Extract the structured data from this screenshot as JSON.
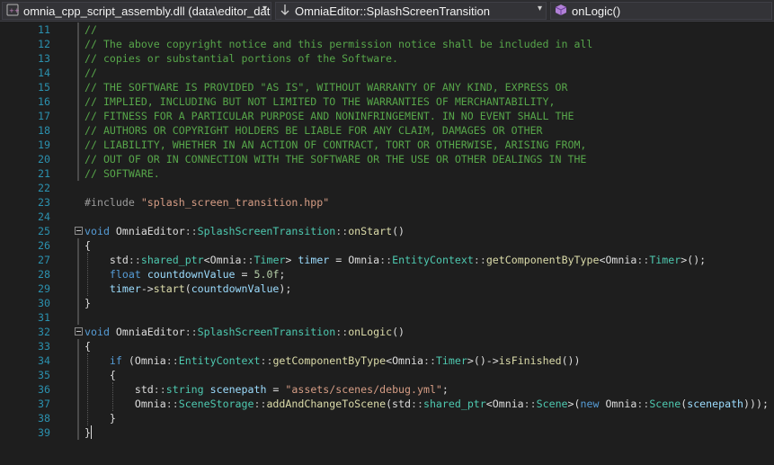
{
  "navigation": {
    "project_dropdown": "omnia_cpp_script_assembly.dll (data\\editor_data\\a",
    "class_dropdown": "OmniaEditor::SplashScreenTransition",
    "member_dropdown": "onLogic()"
  },
  "colors": {
    "comment": "#57a64a",
    "keyword": "#569cd6",
    "type": "#4ec9b0",
    "function": "#dcdcaa",
    "variable": "#9cdcfe",
    "string": "#d69d85",
    "number": "#b5cea8",
    "line_number": "#2b91af"
  },
  "lines": [
    {
      "n": "11",
      "tokens": [
        [
          "comment",
          "//"
        ]
      ]
    },
    {
      "n": "12",
      "tokens": [
        [
          "comment",
          "// The above copyright notice and this permission notice shall be included in all"
        ]
      ]
    },
    {
      "n": "13",
      "tokens": [
        [
          "comment",
          "// copies or substantial portions of the Software."
        ]
      ]
    },
    {
      "n": "14",
      "tokens": [
        [
          "comment",
          "//"
        ]
      ]
    },
    {
      "n": "15",
      "tokens": [
        [
          "comment",
          "// THE SOFTWARE IS PROVIDED \"AS IS\", WITHOUT WARRANTY OF ANY KIND, EXPRESS OR"
        ]
      ]
    },
    {
      "n": "16",
      "tokens": [
        [
          "comment",
          "// IMPLIED, INCLUDING BUT NOT LIMITED TO THE WARRANTIES OF MERCHANTABILITY,"
        ]
      ]
    },
    {
      "n": "17",
      "tokens": [
        [
          "comment",
          "// FITNESS FOR A PARTICULAR PURPOSE AND NONINFRINGEMENT. IN NO EVENT SHALL THE"
        ]
      ]
    },
    {
      "n": "18",
      "tokens": [
        [
          "comment",
          "// AUTHORS OR COPYRIGHT HOLDERS BE LIABLE FOR ANY CLAIM, DAMAGES OR OTHER"
        ]
      ]
    },
    {
      "n": "19",
      "tokens": [
        [
          "comment",
          "// LIABILITY, WHETHER IN AN ACTION OF CONTRACT, TORT OR OTHERWISE, ARISING FROM,"
        ]
      ]
    },
    {
      "n": "20",
      "tokens": [
        [
          "comment",
          "// OUT OF OR IN CONNECTION WITH THE SOFTWARE OR THE USE OR OTHER DEALINGS IN THE"
        ]
      ]
    },
    {
      "n": "21",
      "tokens": [
        [
          "comment",
          "// SOFTWARE."
        ]
      ]
    },
    {
      "n": "22",
      "tokens": []
    },
    {
      "n": "23",
      "tokens": [
        [
          "pre",
          "#include "
        ],
        [
          "string",
          "\"splash_screen_transition.hpp\""
        ]
      ]
    },
    {
      "n": "24",
      "tokens": []
    },
    {
      "n": "25",
      "tokens": [
        [
          "keyword",
          "void"
        ],
        [
          "plain",
          " OmniaEditor"
        ],
        [
          "punct",
          "::"
        ],
        [
          "type",
          "SplashScreenTransition"
        ],
        [
          "punct",
          "::"
        ],
        [
          "func",
          "onStart"
        ],
        [
          "plain",
          "()"
        ]
      ]
    },
    {
      "n": "26",
      "tokens": [
        [
          "plain",
          "{"
        ]
      ]
    },
    {
      "n": "27",
      "tokens": [
        [
          "plain",
          "    std"
        ],
        [
          "punct",
          "::"
        ],
        [
          "type",
          "shared_ptr"
        ],
        [
          "plain",
          "<Omnia"
        ],
        [
          "punct",
          "::"
        ],
        [
          "type",
          "Timer"
        ],
        [
          "plain",
          "> "
        ],
        [
          "var",
          "timer"
        ],
        [
          "plain",
          " = Omnia"
        ],
        [
          "punct",
          "::"
        ],
        [
          "type",
          "EntityContext"
        ],
        [
          "punct",
          "::"
        ],
        [
          "func",
          "getComponentByType"
        ],
        [
          "plain",
          "<Omnia"
        ],
        [
          "punct",
          "::"
        ],
        [
          "type",
          "Timer"
        ],
        [
          "plain",
          ">();"
        ]
      ]
    },
    {
      "n": "28",
      "tokens": [
        [
          "plain",
          "    "
        ],
        [
          "keyword",
          "float"
        ],
        [
          "plain",
          " "
        ],
        [
          "var",
          "countdownValue"
        ],
        [
          "plain",
          " = "
        ],
        [
          "number",
          "5.0f"
        ],
        [
          "plain",
          ";"
        ]
      ]
    },
    {
      "n": "29",
      "tokens": [
        [
          "plain",
          "    "
        ],
        [
          "var",
          "timer"
        ],
        [
          "plain",
          "->"
        ],
        [
          "func",
          "start"
        ],
        [
          "plain",
          "("
        ],
        [
          "var",
          "countdownValue"
        ],
        [
          "plain",
          ");"
        ]
      ]
    },
    {
      "n": "30",
      "tokens": [
        [
          "plain",
          "}"
        ]
      ]
    },
    {
      "n": "31",
      "tokens": []
    },
    {
      "n": "32",
      "tokens": [
        [
          "keyword",
          "void"
        ],
        [
          "plain",
          " OmniaEditor"
        ],
        [
          "punct",
          "::"
        ],
        [
          "type",
          "SplashScreenTransition"
        ],
        [
          "punct",
          "::"
        ],
        [
          "func",
          "onLogic"
        ],
        [
          "plain",
          "()"
        ]
      ]
    },
    {
      "n": "33",
      "tokens": [
        [
          "plain",
          "{"
        ]
      ]
    },
    {
      "n": "34",
      "tokens": [
        [
          "plain",
          "    "
        ],
        [
          "keyword",
          "if"
        ],
        [
          "plain",
          " (Omnia"
        ],
        [
          "punct",
          "::"
        ],
        [
          "type",
          "EntityContext"
        ],
        [
          "punct",
          "::"
        ],
        [
          "func",
          "getComponentByType"
        ],
        [
          "plain",
          "<Omnia"
        ],
        [
          "punct",
          "::"
        ],
        [
          "type",
          "Timer"
        ],
        [
          "plain",
          ">()->"
        ],
        [
          "func",
          "isFinished"
        ],
        [
          "plain",
          "())"
        ]
      ]
    },
    {
      "n": "35",
      "tokens": [
        [
          "plain",
          "    {"
        ]
      ]
    },
    {
      "n": "36",
      "tokens": [
        [
          "plain",
          "        std"
        ],
        [
          "punct",
          "::"
        ],
        [
          "type",
          "string"
        ],
        [
          "plain",
          " "
        ],
        [
          "var",
          "scenepath"
        ],
        [
          "plain",
          " = "
        ],
        [
          "string",
          "\"assets/scenes/debug.yml\""
        ],
        [
          "plain",
          ";"
        ]
      ]
    },
    {
      "n": "37",
      "tokens": [
        [
          "plain",
          "        Omnia"
        ],
        [
          "punct",
          "::"
        ],
        [
          "type",
          "SceneStorage"
        ],
        [
          "punct",
          "::"
        ],
        [
          "func",
          "addAndChangeToScene"
        ],
        [
          "plain",
          "(std"
        ],
        [
          "punct",
          "::"
        ],
        [
          "type",
          "shared_ptr"
        ],
        [
          "plain",
          "<Omnia"
        ],
        [
          "punct",
          "::"
        ],
        [
          "type",
          "Scene"
        ],
        [
          "plain",
          ">("
        ],
        [
          "keyword",
          "new"
        ],
        [
          "plain",
          " Omnia"
        ],
        [
          "punct",
          "::"
        ],
        [
          "type",
          "Scene"
        ],
        [
          "plain",
          "("
        ],
        [
          "var",
          "scenepath"
        ],
        [
          "plain",
          ")));"
        ]
      ]
    },
    {
      "n": "38",
      "tokens": [
        [
          "plain",
          "    }"
        ]
      ]
    },
    {
      "n": "39",
      "tokens": [
        [
          "plain",
          "}"
        ]
      ]
    }
  ]
}
